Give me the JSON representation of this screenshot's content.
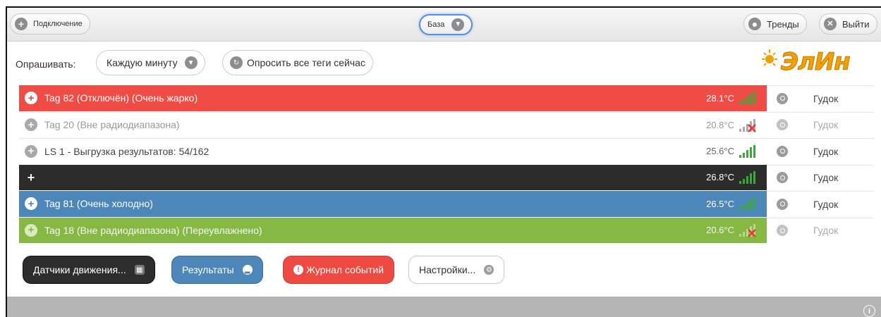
{
  "topbar": {
    "connection_label": "Подключение",
    "base_label": "База",
    "trends_label": "Тренды",
    "exit_label": "Выйти"
  },
  "poll": {
    "label": "Опрашивать:",
    "interval_value": "Каждую минуту",
    "poll_all_label": "Опросить все теги сейчас"
  },
  "logo": {
    "text": "ЭлИн"
  },
  "tags": [
    {
      "name": "Tag 82 (Отключён) (Очень жарко)",
      "temp": "28.1°C",
      "side": "Гудок"
    },
    {
      "name": "Tag 20 (Вне радиодиапазона)",
      "temp": "20.8°C",
      "side": "Гудок"
    },
    {
      "name": "LS 1 - Выгрузка результатов: 54/162",
      "temp": "25.6°C",
      "side": "Гудок"
    },
    {
      "name": "",
      "temp": "26.8°C",
      "side": "Гудок"
    },
    {
      "name": "Tag 81 (Очень холодно)",
      "temp": "26.5°C",
      "side": "Гудок"
    },
    {
      "name": "Tag 18 (Вне радиодиапазона) (Переувлажнено)",
      "temp": "20.6°C",
      "side": "Гудок"
    }
  ],
  "buttons": {
    "motion_sensors": "Датчики движения...",
    "results": "Результаты",
    "event_log": "Журнал событий",
    "settings": "Настройки..."
  },
  "colors": {
    "red": "#f04b45",
    "blue": "#4d87b9",
    "green": "#86b844",
    "black": "#2c2c2c",
    "signal_green": "#3aa83a",
    "logo_orange": "#f0a000"
  }
}
